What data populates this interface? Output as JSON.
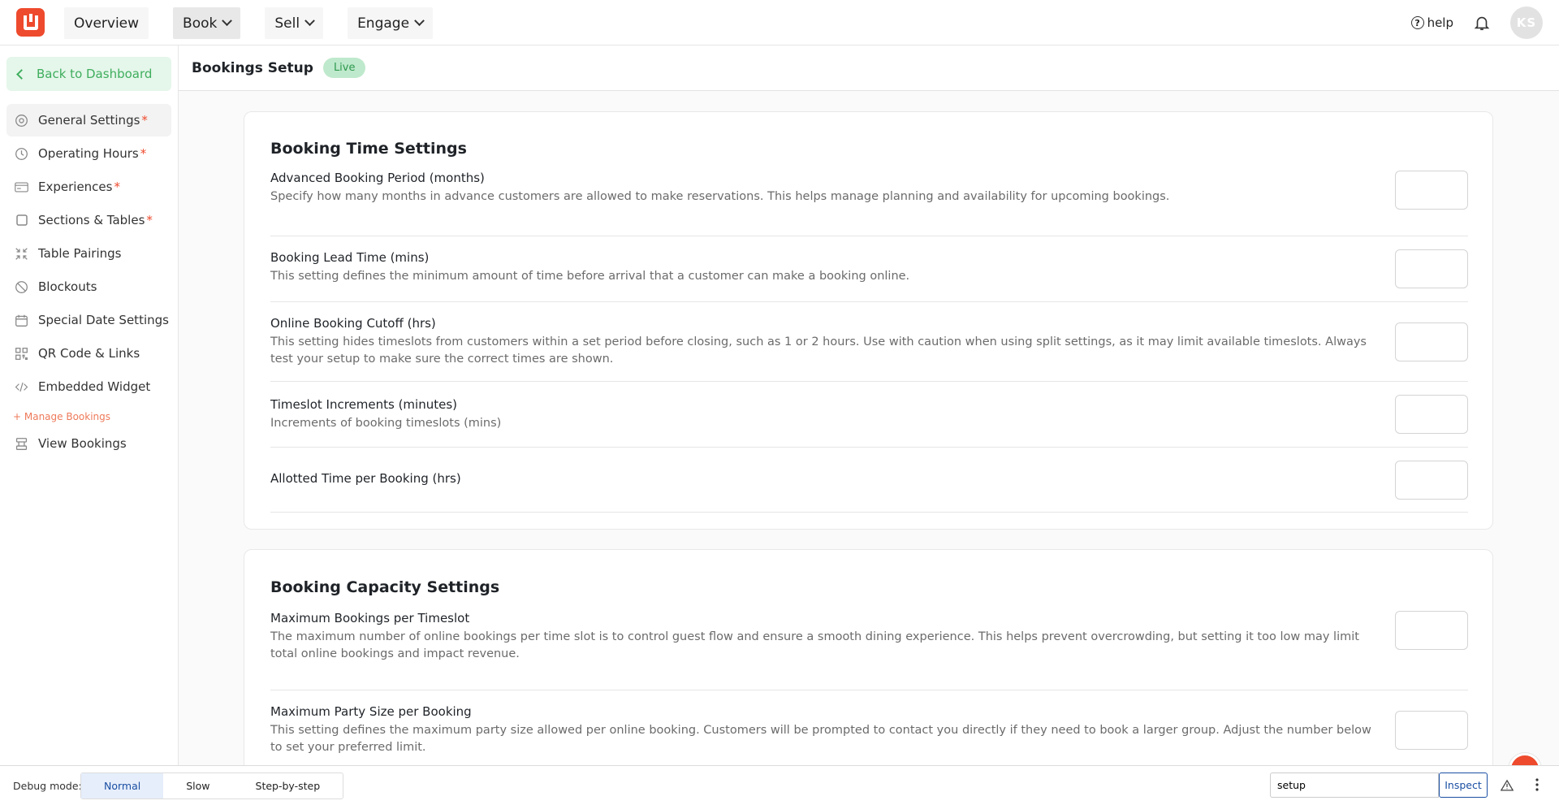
{
  "topnav": {
    "items": [
      {
        "label": "Overview",
        "dropdown": false
      },
      {
        "label": "Book",
        "dropdown": true
      },
      {
        "label": "Sell",
        "dropdown": true
      },
      {
        "label": "Engage",
        "dropdown": true
      }
    ],
    "help_label": "help",
    "avatar_initials": "KS"
  },
  "sidebar": {
    "back_label": "Back to Dashboard",
    "items": [
      {
        "label": "General Settings",
        "required": "*",
        "icon": "settings-icon"
      },
      {
        "label": "Operating Hours",
        "required": "*",
        "icon": "clock-icon"
      },
      {
        "label": "Experiences",
        "required": "*",
        "icon": "card-icon"
      },
      {
        "label": "Sections & Tables",
        "required": "*",
        "icon": "square-icon"
      },
      {
        "label": "Table Pairings",
        "required": "",
        "icon": "collapse-icon"
      },
      {
        "label": "Blockouts",
        "required": "",
        "icon": "block-icon"
      },
      {
        "label": "Special Date Settings",
        "required": "",
        "icon": "calendar-icon"
      },
      {
        "label": "QR Code & Links",
        "required": "",
        "icon": "qr-icon"
      },
      {
        "label": "Embedded Widget",
        "required": "",
        "icon": "code-icon"
      }
    ],
    "section_label": "+ Manage Bookings",
    "section_items": [
      {
        "label": "View Bookings",
        "icon": "bookings-icon"
      }
    ]
  },
  "header": {
    "title": "Bookings Setup",
    "status_badge": "Live"
  },
  "time_settings": {
    "title": "Booking Time Settings",
    "rows": [
      {
        "label": "Advanced Booking Period (months)",
        "desc": "Specify how many months in advance customers are allowed to make reservations. This helps manage planning and availability for upcoming bookings.",
        "value": ""
      },
      {
        "label": "Booking Lead Time (mins)",
        "desc": "This setting defines the minimum amount of time before arrival that a customer can make a booking online.",
        "value": ""
      },
      {
        "label": "Online Booking Cutoff (hrs)",
        "desc": "This setting hides timeslots from customers within a set period before closing, such as 1 or 2 hours. Use with caution when using split settings, as it may limit available timeslots. Always test your setup to make sure the correct times are shown.",
        "value": ""
      },
      {
        "label": "Timeslot Increments (minutes)",
        "desc": "Increments of booking timeslots (mins)",
        "value": ""
      },
      {
        "label": "Allotted Time per Booking (hrs)",
        "desc": "",
        "value": ""
      }
    ]
  },
  "capacity_settings": {
    "title": "Booking Capacity Settings",
    "rows": [
      {
        "label": "Maximum Bookings per Timeslot",
        "desc": "The maximum number of online bookings per time slot is to control guest flow and ensure a smooth dining experience. This helps prevent overcrowding, but setting it too low may limit total online bookings and impact revenue.",
        "value": ""
      },
      {
        "label": "Maximum Party Size per Booking",
        "desc": "This setting defines the maximum party size allowed per online booking. Customers will be prompted to contact you directly if they need to book a larger group. Adjust the number below to set your preferred limit.",
        "value": ""
      }
    ]
  },
  "debugbar": {
    "label": "Debug mode:",
    "modes": [
      "Normal",
      "Slow",
      "Step-by-step"
    ],
    "active_mode": "Normal",
    "search_value": "setup",
    "inspect_label": "Inspect"
  },
  "colors": {
    "brand": "#ee4a2d",
    "live_green": "#2e9a4f",
    "back_green": "#3fae5e"
  }
}
